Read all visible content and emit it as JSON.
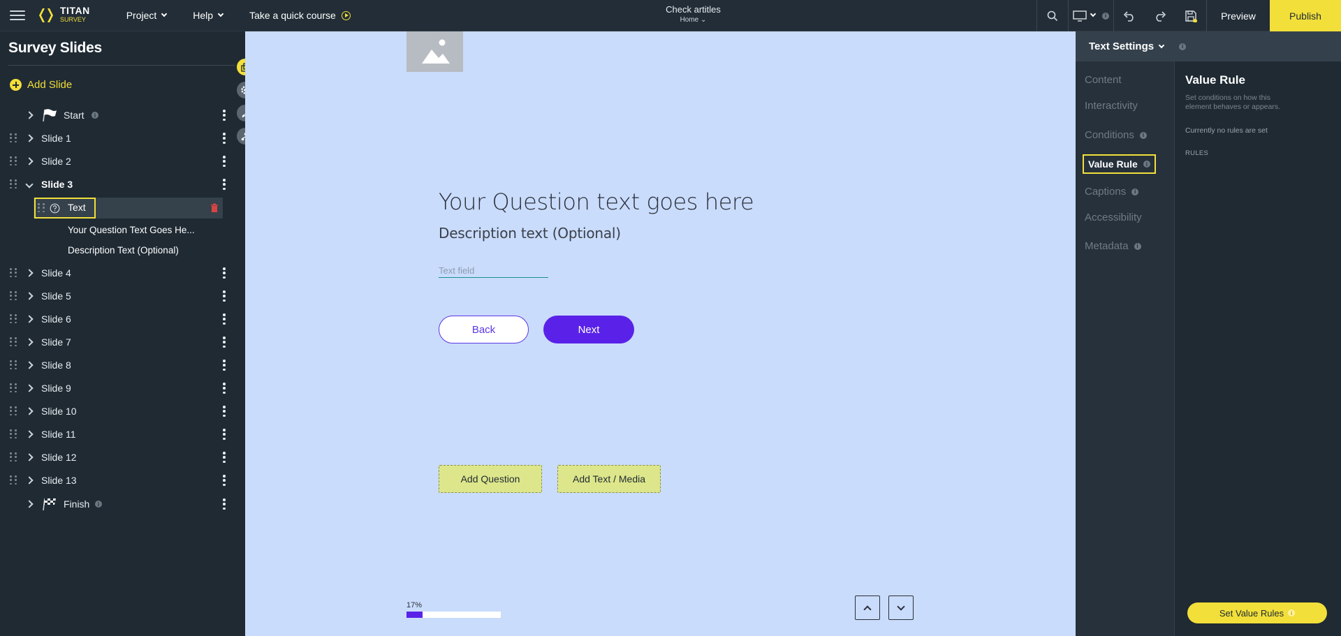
{
  "topbar": {
    "logo_title": "TITAN",
    "logo_sub": "SURVEY",
    "menu": [
      {
        "label": "Project"
      },
      {
        "label": "Help"
      },
      {
        "label": "Take a quick course"
      }
    ],
    "center_title": "Check artitles",
    "center_sub": "Home",
    "preview_label": "Preview",
    "publish_label": "Publish",
    "info_glyph": "i"
  },
  "sidebar": {
    "title": "Survey Slides",
    "add_slide_label": "Add Slide",
    "start_label": "Start",
    "finish_label": "Finish",
    "slides": [
      {
        "label": "Slide 1"
      },
      {
        "label": "Slide 2"
      },
      {
        "label": "Slide 3"
      },
      {
        "label": "Slide 4"
      },
      {
        "label": "Slide 5"
      },
      {
        "label": "Slide 6"
      },
      {
        "label": "Slide 7"
      },
      {
        "label": "Slide 8"
      },
      {
        "label": "Slide 9"
      },
      {
        "label": "Slide 10"
      },
      {
        "label": "Slide 11"
      },
      {
        "label": "Slide 12"
      },
      {
        "label": "Slide 13"
      }
    ],
    "slide3_children": {
      "text_label": "Text",
      "items": [
        {
          "label": "Your Question Text Goes He..."
        },
        {
          "label": "Description Text (Optional)"
        }
      ]
    }
  },
  "canvas": {
    "question": "Your Question text goes here",
    "description": "Description text (Optional)",
    "text_field_placeholder": "Text field",
    "back_label": "Back",
    "next_label": "Next",
    "add_question_label": "Add Question",
    "add_text_media_label": "Add Text / Media",
    "progress_label": "17%",
    "progress_value": 0.17
  },
  "settings": {
    "header_title": "Text Settings",
    "nav": [
      {
        "label": "Content"
      },
      {
        "label": "Interactivity"
      },
      {
        "label": "Conditions"
      },
      {
        "label": "Value Rule"
      },
      {
        "label": "Captions"
      },
      {
        "label": "Accessibility"
      },
      {
        "label": "Metadata"
      }
    ],
    "value_rule": {
      "title": "Value Rule",
      "description": "Set conditions on how this element behaves or appears.",
      "no_rules": "Currently no rules are set",
      "rules_heading": "RULES",
      "button_label": "Set Value Rules"
    }
  },
  "colors": {
    "accent_yellow": "#f2df3a",
    "primary_purple": "#5a22e8",
    "canvas_bg": "#c9dcfb",
    "panel_bg": "#1f2a33"
  },
  "icons": [
    "hamburger-icon",
    "titan-logo-icon",
    "play-circle-icon",
    "search-icon",
    "desktop-icon",
    "undo-icon",
    "redo-icon",
    "save-icon",
    "plus-circle-icon",
    "flag-icon",
    "checkered-flag-icon",
    "drag-handle-icon",
    "chevron-right-icon",
    "kebab-icon",
    "question-circle-icon",
    "trash-icon",
    "image-placeholder-icon",
    "arrow-up-icon",
    "arrow-down-icon"
  ]
}
